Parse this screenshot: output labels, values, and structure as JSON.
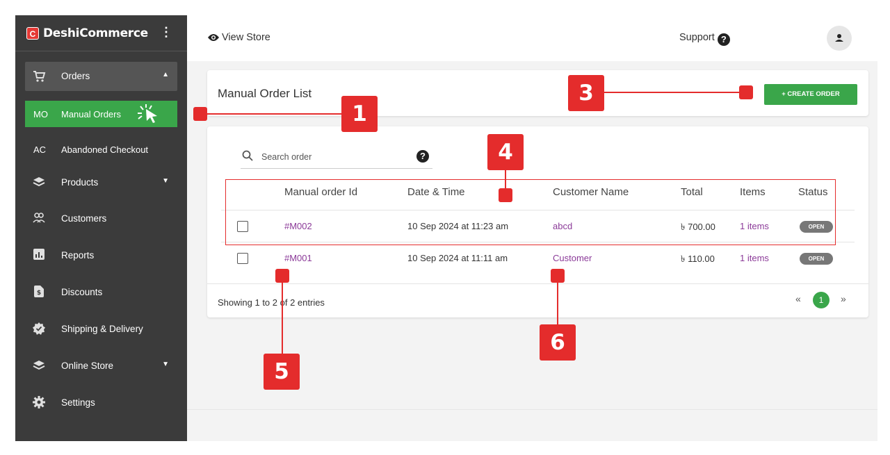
{
  "brand": {
    "logo_letter": "C",
    "name": "DeshiCommerce",
    "menu_glyph": "⋮"
  },
  "sidebar": {
    "orders_label": "Orders",
    "submenu": [
      {
        "abbr": "MO",
        "label": "Manual Orders"
      },
      {
        "abbr": "AC",
        "label": "Abandoned Checkout"
      }
    ],
    "items": [
      {
        "icon": "products-icon",
        "label": "Products"
      },
      {
        "icon": "customers-icon",
        "label": "Customers"
      },
      {
        "icon": "reports-icon",
        "label": "Reports"
      },
      {
        "icon": "discounts-icon",
        "label": "Discounts"
      },
      {
        "icon": "shipping-icon",
        "label": "Shipping & Delivery"
      },
      {
        "icon": "online-store-icon",
        "label": "Online Store"
      },
      {
        "icon": "settings-icon",
        "label": "Settings"
      }
    ]
  },
  "topbar": {
    "view_store": "View Store",
    "support": "Support"
  },
  "page": {
    "title": "Manual Order List",
    "create_button": "+ CREATE ORDER",
    "search_placeholder": "Search order",
    "columns": [
      "Manual order Id",
      "Date & Time",
      "Customer Name",
      "Total",
      "Items",
      "Status"
    ],
    "rows": [
      {
        "id": "#M002",
        "datetime": "10 Sep 2024 at 11:23 am",
        "customer": "abcd",
        "total": "৳ 700.00",
        "items": "1 items",
        "status": "OPEN"
      },
      {
        "id": "#M001",
        "datetime": "10 Sep 2024 at 11:11 am",
        "customer": "Customer",
        "total": "৳ 110.00",
        "items": "1 items",
        "status": "OPEN"
      }
    ],
    "showing": "Showing 1 to 2 of 2 entries",
    "pagination": {
      "prev": "«",
      "current": "1",
      "next": "»"
    }
  },
  "annotations": [
    "1",
    "3",
    "4",
    "5",
    "6"
  ],
  "colors": {
    "accent_green": "#3aa64a",
    "annotation_red": "#e42c2c",
    "link_purple": "#8b3a98",
    "sidebar_bg": "#3b3b3b"
  }
}
